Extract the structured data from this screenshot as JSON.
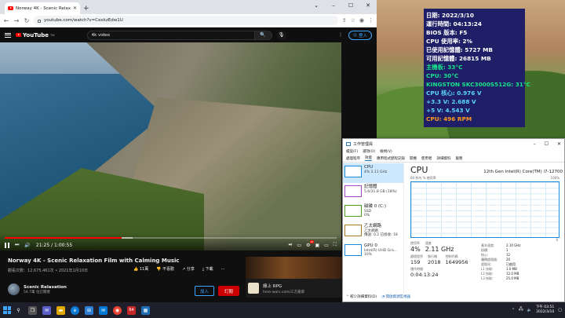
{
  "browser": {
    "tab_title": "Norway 4K - Scenic Relaxati",
    "url": "youtube.com/watch?v=CexkzEdw1U"
  },
  "youtube": {
    "logo": "YouTube",
    "logo_region": "TW",
    "search_value": "4k video",
    "sign_in": "登入"
  },
  "player": {
    "time": "21:25 / 1:00:55",
    "progress_played": 0.352,
    "progress_buffered": 0.385
  },
  "video": {
    "title": "Norway 4K - Scenic Relaxation Film with Calming Music",
    "meta": "觀看次數：12,675,461次 • 2021年1月10日",
    "actions": {
      "like": "11萬",
      "dislike": "不喜歡",
      "share": "分享",
      "download": "下載",
      "more": "..."
    },
    "channel": {
      "name": "Scenic Relaxation",
      "subs": "54.7萬 位訂閱者",
      "join": "加入",
      "subscribe": "訂閱"
    }
  },
  "ad": {
    "title": "綠上 RPG",
    "url": "hero-wars.com/三方豪眾"
  },
  "osd": {
    "lines": [
      {
        "text": "日期: 2022/3/10",
        "color": "#ffffff"
      },
      {
        "text": "運行時間: 04:13:24",
        "color": "#ffffff"
      },
      {
        "text": "BIOS 版本: F5",
        "color": "#ffffff"
      },
      {
        "text": "CPU 使用率: 2%",
        "color": "#ffffff"
      },
      {
        "text": "已使用記憶體: 5727 MB",
        "color": "#ffffff"
      },
      {
        "text": "可用記憶體: 26815 MB",
        "color": "#ffffff"
      },
      {
        "text": "主機板: 33°C",
        "color": "#19e28b"
      },
      {
        "text": "CPU: 30°C",
        "color": "#19e28b"
      },
      {
        "text": "KINGSTON SKC3000S512G: 31°C",
        "color": "#19e28b"
      },
      {
        "text": "CPU 核心: 0.976 V",
        "color": "#5dd6ff"
      },
      {
        "text": "+3.3 V: 2.688 V",
        "color": "#5dd6ff"
      },
      {
        "text": "+5 V: 4.543 V",
        "color": "#5dd6ff"
      },
      {
        "text": "CPU: 496 RPM",
        "color": "#ff9a1f"
      }
    ]
  },
  "taskmgr": {
    "title": "工作管理員",
    "menu": [
      "檔案(F)",
      "選項(O)",
      "檢視(V)"
    ],
    "tabs": [
      "處理程序",
      "效能",
      "應用程式歷程記錄",
      "開機",
      "使用者",
      "詳細資料",
      "服務"
    ],
    "active_tab": 1,
    "side": [
      {
        "name": "CPU",
        "l1": "4% 2.11 GHz",
        "l2": "",
        "kind": "cpu"
      },
      {
        "name": "記憶體",
        "l1": "5.6/31.8 GB (18%)",
        "l2": "",
        "kind": "mem"
      },
      {
        "name": "磁碟 0 (C:)",
        "l1": "SSD",
        "l2": "0%",
        "kind": "disk"
      },
      {
        "name": "乙太網路",
        "l1": "乙太網路",
        "l2": "傳送: 0.2 已接收: 18",
        "kind": "net"
      },
      {
        "name": "GPU 0",
        "l1": "Intel(R) UHD Gra...",
        "l2": "10%",
        "kind": "gpu"
      }
    ],
    "heading": "CPU",
    "model": "12th Gen Intel(R) Core(TM) i7-12700",
    "graph_label_left": "60 秒內 % 使用率",
    "graph_label_right": "100%",
    "graph_label_bottom_right": "0",
    "stats": {
      "util_label": "使用率",
      "util": "4%",
      "speed_label": "速度",
      "speed": "2.11 GHz",
      "proc_label": "處理程序",
      "proc": "159",
      "thread_label": "執行緒",
      "thread": "2018",
      "handle_label": "控制代碼",
      "handle": "1649956",
      "uptime_label": "運作時間",
      "uptime": "0:04:13:24"
    },
    "spec": [
      {
        "k": "基本速度:",
        "v": "2.10 GHz"
      },
      {
        "k": "插槽:",
        "v": "1"
      },
      {
        "k": "核心:",
        "v": "12"
      },
      {
        "k": "邏輯處理器:",
        "v": "20"
      },
      {
        "k": "虛擬化:",
        "v": "已啟用"
      },
      {
        "k": "L1 快取:",
        "v": "1.0 MB"
      },
      {
        "k": "L2 快取:",
        "v": "12.0 MB"
      },
      {
        "k": "L3 快取:",
        "v": "25.0 MB"
      }
    ],
    "footer_less": "較少詳細資料(D)",
    "footer_link": "開啟資源監視器"
  },
  "taskbar": {
    "badge": "64",
    "time": "下午 03:51",
    "date": "2022/3/10"
  }
}
